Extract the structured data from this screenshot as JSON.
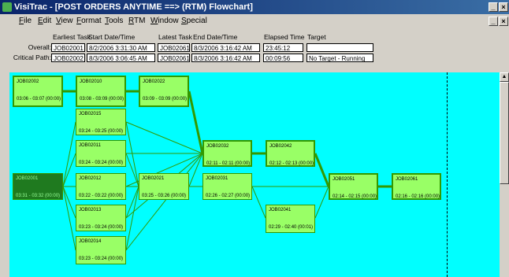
{
  "window": {
    "title": "VisiTrac  - [POST ORDERS ANYTIME ==> (RTM) Flowchart]"
  },
  "menu": [
    "File",
    "Edit",
    "View",
    "Format",
    "Tools",
    "RTM",
    "Window",
    "Special"
  ],
  "menu_keys": [
    "F",
    "E",
    "V",
    "F",
    "T",
    "R",
    "W",
    "S"
  ],
  "summary": {
    "headers": {
      "earliest": "Earliest Task",
      "start": "Start Date/Time",
      "latest": "Latest Task",
      "end": "End Date/Time",
      "elapsed": "Elapsed Time",
      "target": "Target"
    },
    "rows": [
      {
        "label": "Overall:",
        "earliest": "JOB02001",
        "start": "8/2/2006 3:31:30 AM",
        "latest": "JOB02061",
        "end": "8/3/2006 3:16:42 AM",
        "elapsed": "23:45:12",
        "target": ""
      },
      {
        "label": "Critical Path:",
        "earliest": "JOB02002",
        "start": "8/3/2006 3:06:45 AM",
        "latest": "JOB02061",
        "end": "8/3/2006 3:16:42 AM",
        "elapsed": "00:09:56",
        "target": "No Target - Running"
      }
    ]
  },
  "nodes": [
    {
      "id": "JOB02002",
      "dt": "03:06 - 03:07 (00:00)"
    },
    {
      "id": "JOB02010",
      "dt": "03:08 - 03:09 (00:00)"
    },
    {
      "id": "JOB02022",
      "dt": "03:09 - 03:09 (00:00)"
    },
    {
      "id": "JOB02015",
      "dt": "03:24 - 03:25 (00:00)"
    },
    {
      "id": "JOB02011",
      "dt": "03:24 - 03:24 (00:00)"
    },
    {
      "id": "JOB02001",
      "dt": "03:31 - 03:32 (00:00)"
    },
    {
      "id": "JOB02012",
      "dt": "03:22 - 03:22 (00:00)"
    },
    {
      "id": "JOB02021",
      "dt": "03:25 - 03:26 (00:00)"
    },
    {
      "id": "JOB02032",
      "dt": "02:11 - 02:11 (00:00)"
    },
    {
      "id": "JOB02042",
      "dt": "02:12 - 02:13 (00:00)"
    },
    {
      "id": "JOB02051",
      "dt": "02:14 - 02:15 (00:00)"
    },
    {
      "id": "JOB02061",
      "dt": "02:16 - 02:16 (00:00)"
    },
    {
      "id": "JOB02031",
      "dt": "02:26 - 02:27 (00:00)"
    },
    {
      "id": "JOB02013",
      "dt": "03:23 - 03:24 (00:00)"
    },
    {
      "id": "JOB02041",
      "dt": "02:29 - 02:40 (00:01)"
    },
    {
      "id": "JOB02014",
      "dt": "03:23 - 03:24 (00:00)"
    }
  ]
}
